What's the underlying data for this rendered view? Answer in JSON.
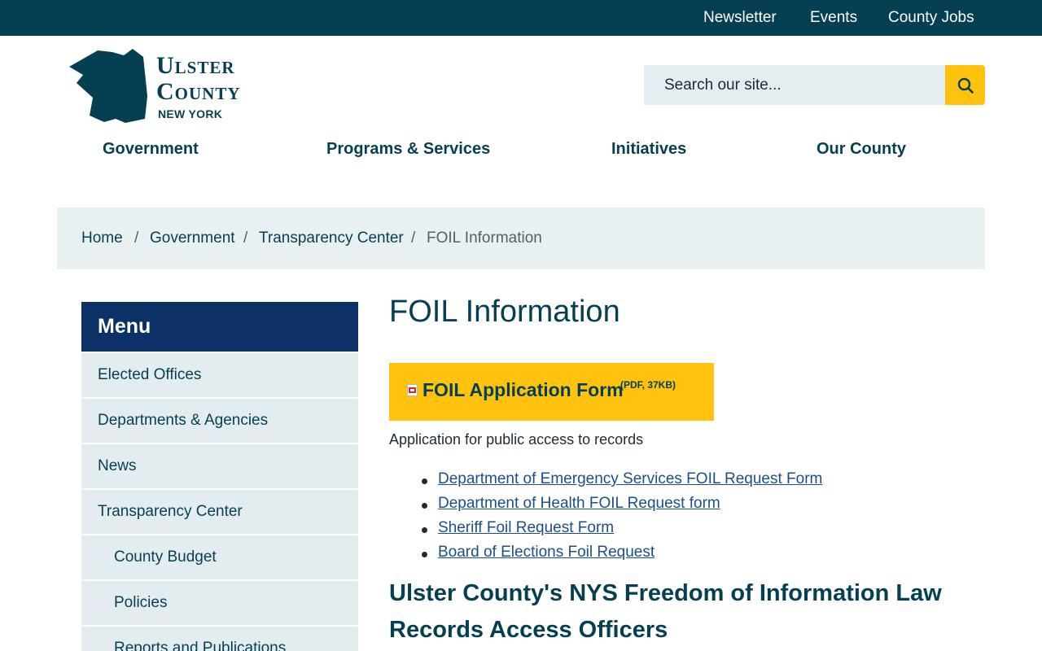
{
  "utility_nav": {
    "items": [
      "Newsletter",
      "Events",
      "County Jobs"
    ]
  },
  "logo": {
    "line1": "Ulster",
    "line2": "County",
    "line3": "NEW YORK"
  },
  "search": {
    "placeholder": "Search our site..."
  },
  "main_nav": {
    "items": [
      "Government",
      "Programs & Services",
      "Initiatives",
      "Our County"
    ]
  },
  "breadcrumb": {
    "items": [
      "Home",
      "Government",
      "Transparency Center"
    ],
    "separator": "/",
    "current": "FOIL Information"
  },
  "sidebar": {
    "title": "Menu",
    "items": [
      {
        "label": "Elected Offices"
      },
      {
        "label": "Departments & Agencies"
      },
      {
        "label": "News"
      },
      {
        "label": "Transparency Center"
      },
      {
        "label": "County Budget"
      },
      {
        "label": "Policies"
      },
      {
        "label": "Reports and Publications"
      }
    ]
  },
  "content": {
    "title": "FOIL Information",
    "foil_button": {
      "label": "FOIL Application Form",
      "meta": "(PDF, 37KB)"
    },
    "description": "Application for public access to records",
    "links": [
      "Department of Emergency Services FOIL Request Form",
      "Department of Health FOIL Request form",
      "Sheriff Foil Request Form",
      "Board of Elections Foil Request"
    ],
    "section_heading": "Ulster County's NYS Freedom of Information Law Records Access Officers"
  },
  "colors": {
    "brand_dark": "#053f52",
    "menu_header": "#0b3167",
    "accent_yellow": "#ffc20e",
    "link": "#1b4f8c"
  },
  "icons": {
    "search": "magnifier-icon",
    "pdf": "pdf-file-icon",
    "logo": "county-map-logo-icon"
  }
}
